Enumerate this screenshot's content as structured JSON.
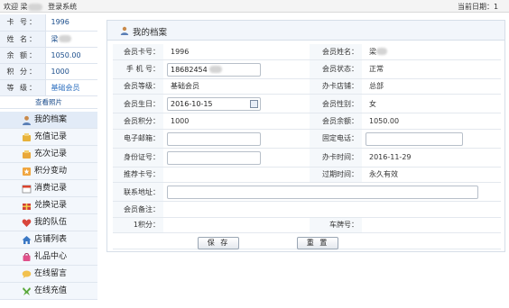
{
  "topbar": {
    "welcome": "欢迎 梁",
    "login_label": "登录系统",
    "date_label": "当前日期：1"
  },
  "member": {
    "card_no_label": "卡  号：",
    "card_no": "1996",
    "name_label": "姓  名：",
    "name": "梁",
    "balance_label": "余  额：",
    "balance": "1050.00",
    "points_label": "积  分：",
    "points": "1000",
    "level_label": "等  级：",
    "level": "基础会员",
    "photo_link": "查看照片"
  },
  "menu": [
    {
      "label": "我的档案",
      "icon": "user-icon"
    },
    {
      "label": "充值记录",
      "icon": "coins-icon"
    },
    {
      "label": "充次记录",
      "icon": "coins-stack-icon"
    },
    {
      "label": "积分变动",
      "icon": "star-icon"
    },
    {
      "label": "消费记录",
      "icon": "calendar-icon"
    },
    {
      "label": "兑换记录",
      "icon": "gift-box-icon"
    },
    {
      "label": "我的队伍",
      "icon": "heart-icon"
    },
    {
      "label": "店铺列表",
      "icon": "home-icon"
    },
    {
      "label": "礼品中心",
      "icon": "bag-icon"
    },
    {
      "label": "在线留言",
      "icon": "message-icon"
    },
    {
      "label": "在线充值",
      "icon": "ribbon-icon"
    }
  ],
  "panel": {
    "title": "我的档案",
    "fields": {
      "card_no_label": "会员卡号：",
      "card_no": "1996",
      "name_label": "会员姓名：",
      "name": "梁",
      "phone_label": "手 机 号：",
      "phone": "18682454",
      "status_label": "会员状态：",
      "status": "正常",
      "level_label": "会员等级：",
      "level": "基础会员",
      "store_label": "办卡店铺：",
      "store": "总部",
      "birthday_label": "会员生日：",
      "birthday": "2016-10-15",
      "gender_label": "会员性别：",
      "gender": "女",
      "points_label": "会员积分：",
      "points": "1000",
      "balance_label": "会员余额：",
      "balance": "1050.00",
      "email_label": "电子邮箱：",
      "email": "",
      "tel_label": "固定电话：",
      "tel": "",
      "id_label": "身份证号：",
      "id": "",
      "open_time_label": "办卡时间：",
      "open_time": "2016-11-29",
      "referrer_label": "推荐卡号：",
      "referrer": "",
      "expire_label": "过期时间：",
      "expire": "永久有效",
      "address_label": "联系地址：",
      "address": "",
      "remark_label": "会员备注：",
      "remark": "",
      "points1_label": "1积分：",
      "plate_label": "车牌号："
    },
    "save_label": "保  存",
    "reset_label": "重  置"
  }
}
